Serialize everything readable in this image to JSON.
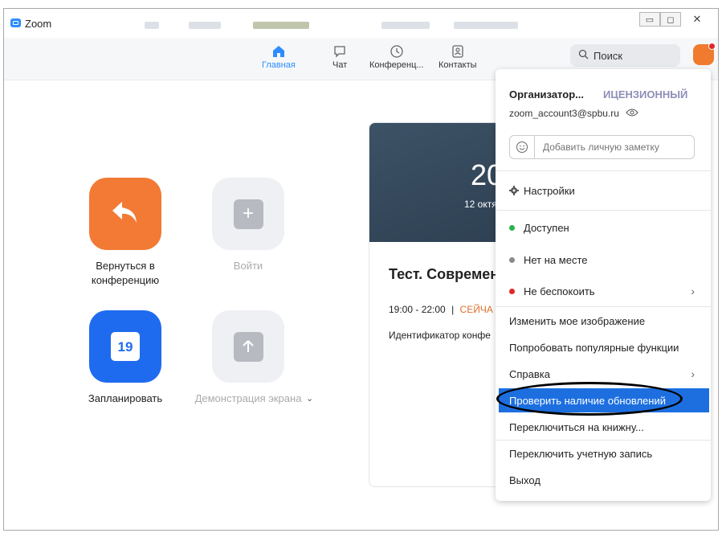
{
  "window": {
    "title": "Zoom"
  },
  "nav": [
    {
      "label": "Главная",
      "icon": "home-icon"
    },
    {
      "label": "Чат",
      "icon": "chat-icon"
    },
    {
      "label": "Конференц...",
      "icon": "clock-icon"
    },
    {
      "label": "Контакты",
      "icon": "contacts-icon"
    }
  ],
  "search": {
    "label": "Поиск"
  },
  "tiles": {
    "return": "Вернуться в конференцию",
    "join": "Войти",
    "schedule": "Запланировать",
    "schedule_day": "19",
    "share": "Демонстрация экрана"
  },
  "card": {
    "big_number": "20",
    "date": "12 октя",
    "title": "Тест. Современ",
    "time": "19:00 - 22:00",
    "separator": "|",
    "now": "СЕЙЧА",
    "id_label": "Идентификатор конфе"
  },
  "menu": {
    "name": "Организатор...",
    "license": "ИЦЕНЗИОННЫЙ",
    "email": "zoom_account3@spbu.ru",
    "note_placeholder": "Добавить личную заметку",
    "settings": "Настройки",
    "available": "Доступен",
    "away": "Нет на месте",
    "dnd": "Не беспокоить",
    "change_picture": "Изменить мое изображение",
    "try_features": "Попробовать популярные функции",
    "help": "Справка",
    "check_updates": "Проверить наличие обновлений",
    "portrait": "Переключиться на книжну...",
    "switch_account": "Переключить учетную запись",
    "logout": "Выход"
  },
  "colors": {
    "accent": "#2D8CFF",
    "orange": "#F27A34",
    "blue_tile": "#1F6BF0",
    "available": "#2BB24C",
    "away": "#8A8A8A",
    "dnd": "#E02828",
    "highlight": "#1D6FE0"
  }
}
